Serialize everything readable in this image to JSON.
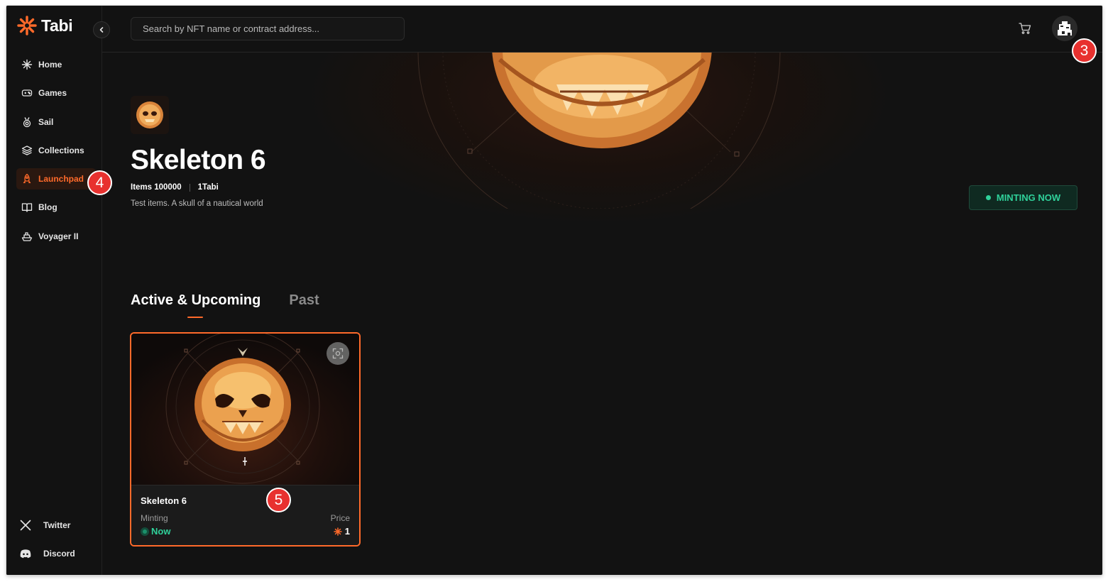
{
  "app": {
    "brand": "Tabi"
  },
  "colors": {
    "accent": "#ff6a2a",
    "success": "#2fd19a",
    "background": "#121212"
  },
  "sidebar": {
    "items": [
      {
        "label": "Home",
        "icon": "sparkle-icon"
      },
      {
        "label": "Games",
        "icon": "gamepad-icon"
      },
      {
        "label": "Sail",
        "icon": "medal-icon"
      },
      {
        "label": "Collections",
        "icon": "layers-icon"
      },
      {
        "label": "Launchpad",
        "icon": "rocket-icon",
        "active": true
      },
      {
        "label": "Blog",
        "icon": "book-icon"
      },
      {
        "label": "Voyager II",
        "icon": "ship-icon"
      }
    ],
    "social": [
      {
        "label": "Twitter",
        "icon": "x-logo-icon"
      },
      {
        "label": "Discord",
        "icon": "discord-icon"
      }
    ]
  },
  "header": {
    "search_placeholder": "Search by NFT name or contract address..."
  },
  "hero": {
    "title": "Skeleton 6",
    "items_label": "Items 100000",
    "price_label": "1Tabi",
    "description": "Test items. A skull of a nautical world",
    "status_badge": "MINTING NOW"
  },
  "tabs": [
    {
      "label": "Active & Upcoming",
      "active": true
    },
    {
      "label": "Past",
      "active": false
    }
  ],
  "cards": [
    {
      "title": "Skeleton 6",
      "left_label": "Minting",
      "left_value": "Now",
      "right_label": "Price",
      "right_value": "1"
    }
  ],
  "markers": [
    "3",
    "4",
    "5"
  ]
}
